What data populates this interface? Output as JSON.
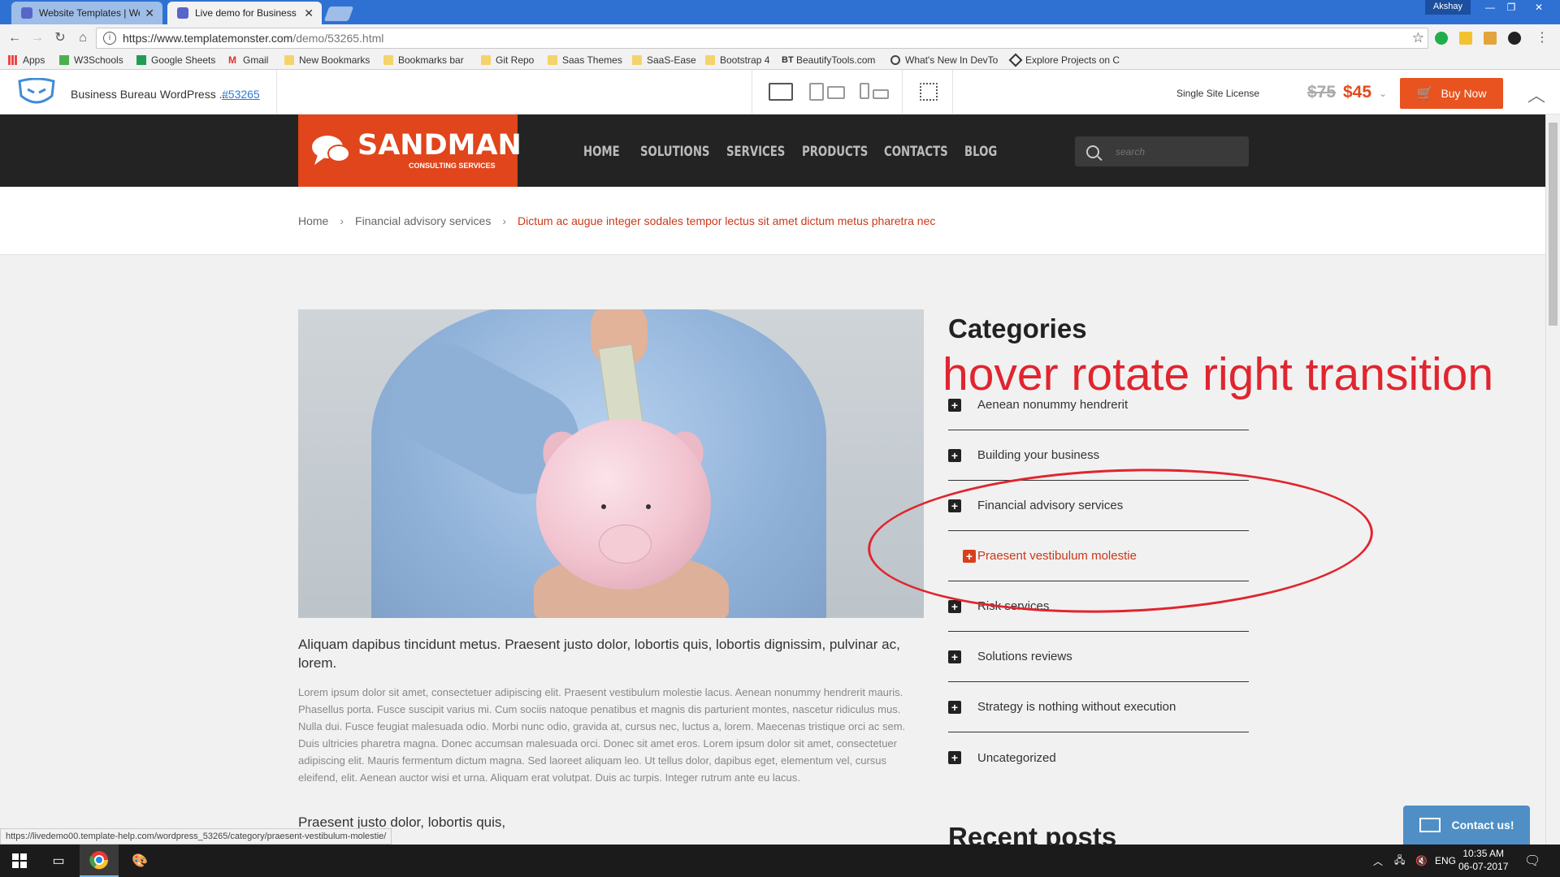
{
  "browser": {
    "tabs": [
      {
        "label": "Website Templates | Web",
        "close": "✕"
      },
      {
        "label": "Live demo for Business B",
        "close": "✕"
      }
    ],
    "user": "Akshay",
    "url_host": "https://www.templatemonster.com",
    "url_path": "/demo/53265.html",
    "bookmarks": [
      "Apps",
      "W3Schools",
      "Google Sheets",
      "Gmail",
      "New Bookmarks",
      "Bookmarks bar",
      "Git Repo",
      "Saas Themes",
      "SaaS-Ease",
      "Bootstrap 4",
      "BeautifyTools.com",
      "What's New In DevTo",
      "Explore Projects on C"
    ],
    "status_url": "https://livedemo00.template-help.com/wordpress_53265/category/praesent-vestibulum-molestie/"
  },
  "demo_bar": {
    "title": "Business Bureau WordPress ...",
    "id": "#53265",
    "license": "Single Site License",
    "old_price": "$75",
    "new_price": "$45",
    "buy_label": "Buy Now",
    "accent": "#e8531f"
  },
  "site": {
    "logo_name": "SANDMAN",
    "logo_sub": "CONSULTING SERVICES",
    "brand_color": "#e0451b",
    "menu": [
      "HOME",
      "SOLUTIONS",
      "SERVICES",
      "PRODUCTS",
      "CONTACTS",
      "BLOG"
    ],
    "search_placeholder": "search"
  },
  "breadcrumb": {
    "home": "Home",
    "parent": "Financial advisory services",
    "current": "Dictum ac augue integer sodales tempor lectus sit amet dictum metus pharetra nec"
  },
  "article": {
    "lead": "Aliquam dapibus tincidunt metus. Praesent justo dolor, lobortis quis, lobortis dignissim, pulvinar ac, lorem.",
    "body": "Lorem ipsum dolor sit amet, consectetuer adipiscing elit. Praesent vestibulum molestie lacus. Aenean nonummy hendrerit mauris. Phasellus porta. Fusce suscipit varius mi. Cum sociis natoque penatibus et magnis dis parturient montes, nascetur ridiculus mus. Nulla dui. Fusce feugiat malesuada odio. Morbi nunc odio, gravida at, cursus nec, luctus a, lorem. Maecenas tristique orci ac sem. Duis ultricies pharetra magna. Donec accumsan malesuada orci. Donec sit amet eros. Lorem ipsum dolor sit amet, consectetuer adipiscing elit. Mauris fermentum dictum magna. Sed laoreet aliquam leo. Ut tellus dolor, dapibus eget, elementum vel, cursus eleifend, elit. Aenean auctor wisi et urna. Aliquam erat volutpat. Duis ac turpis. Integer rutrum ante eu lacus.",
    "subhead": "Praesent justo dolor, lobortis quis,"
  },
  "sidebar": {
    "categories_title": "Categories",
    "annotation": "hover rotate right transition",
    "categories": [
      "Aenean nonummy hendrerit",
      "Building your business",
      "Financial advisory services",
      "Praesent vestibulum molestie",
      "Risk services",
      "Solutions reviews",
      "Strategy is nothing without execution",
      "Uncategorized"
    ],
    "recent_title": "Recent posts",
    "contact_label": "Contact us!"
  },
  "taskbar": {
    "language": "ENG",
    "time": "10:35 AM",
    "date": "06-07-2017"
  }
}
